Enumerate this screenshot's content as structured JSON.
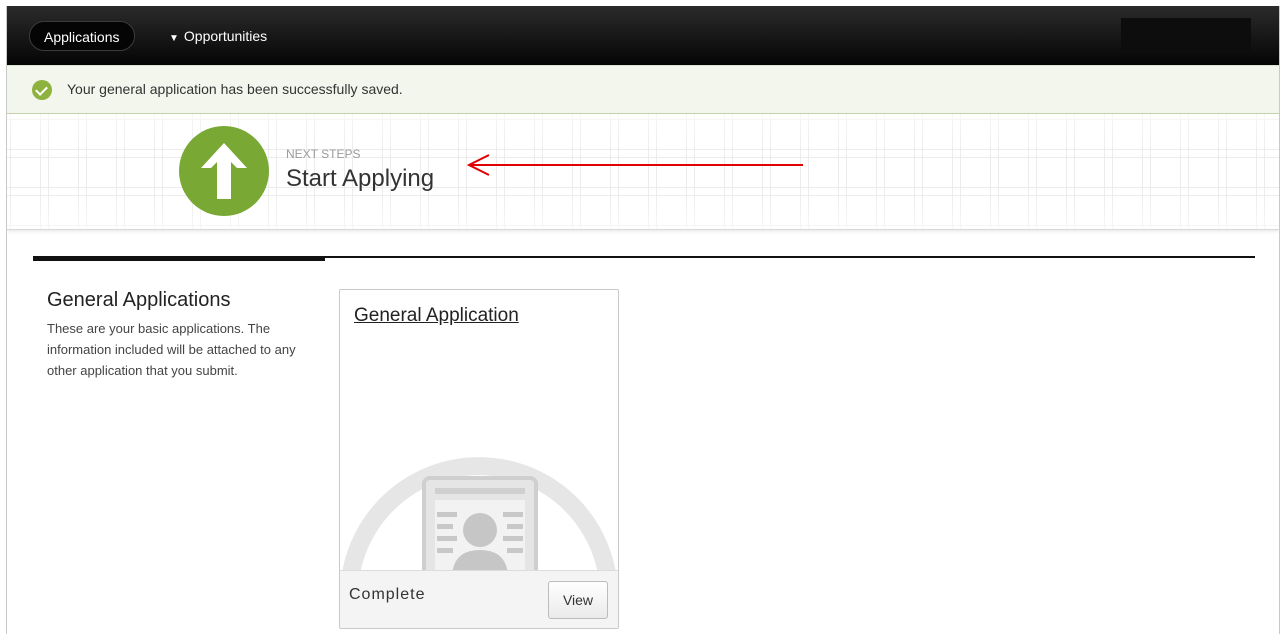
{
  "nav": {
    "applications_label": "Applications",
    "opportunities_label": "Opportunities",
    "opportunities_icon": "caret-down-icon"
  },
  "alert": {
    "message": "Your general application has been successfully saved.",
    "icon": "check-circle-icon",
    "color": "#8db23e"
  },
  "hero": {
    "kicker": "NEXT STEPS",
    "title": "Start Applying",
    "icon": "up-arrow-icon",
    "icon_color": "#79a834",
    "annotation_color": "#e00000"
  },
  "section": {
    "title": "General Applications",
    "description": "These are your basic applications. The information included will be attached to any other application that you submit."
  },
  "card": {
    "title": "General Application",
    "status": "Complete",
    "view_label": "View",
    "illustration": "profile-document-icon"
  }
}
